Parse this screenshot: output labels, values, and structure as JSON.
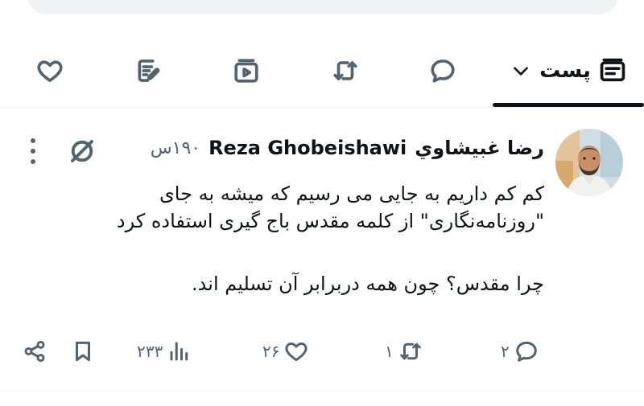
{
  "tabs": {
    "posts_label": "پست",
    "items": [
      "posts",
      "replies",
      "retweets",
      "media",
      "articles",
      "likes"
    ]
  },
  "tweet": {
    "display_name_fa": "رضا غبیشاوي",
    "display_name_en": "Reza Ghobeishawi",
    "time": "۱۹۰س",
    "lines": [
      "کم کم داریم به جایی می رسیم که میشه به جای",
      "\"روزنامه‌نگاری\" از کلمه مقدس باج گیری استفاده کرد",
      "چرا مقدس؟ چون همه دربرابر آن تسلیم اند."
    ],
    "counts": {
      "replies": "۲",
      "retweets": "۱",
      "likes": "۲۶",
      "views": "۲۳۳"
    }
  },
  "colors": {
    "text": "#0f1419",
    "muted": "#536471",
    "divider": "#eff3f4"
  },
  "icons": [
    "heart-icon",
    "compose-article-icon",
    "media-icon",
    "retweet-icon",
    "reply-icon",
    "chevron-down-icon",
    "timeline-icon",
    "grok-icon",
    "more-icon",
    "share-icon",
    "bookmark-icon",
    "views-icon"
  ]
}
